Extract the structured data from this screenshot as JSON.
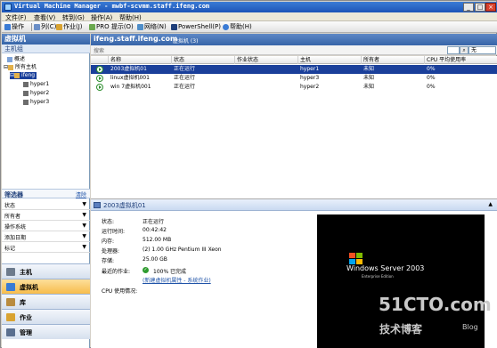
{
  "window": {
    "title": "Virtual Machine Manager - mwbf-scvmm.staff.ifeng.com"
  },
  "menu": [
    "文件(F)",
    "查看(V)",
    "转到(G)",
    "操作(A)",
    "帮助(H)"
  ],
  "toolbar": {
    "items": [
      "操作",
      "列(C)",
      "作业(J)",
      "PRO 提示(O)",
      "网络(N)",
      "PowerShell(P)",
      "帮助(H)"
    ]
  },
  "left": {
    "title": "虚拟机",
    "section": "主机组",
    "tree": [
      "概述",
      "所有主机",
      "ifeng",
      "hyper1",
      "hyper2",
      "hyper3"
    ],
    "filter": {
      "title": "筛选器",
      "clear": "清除",
      "rows": [
        "状态",
        "所有者",
        "操作系统",
        "添加日期",
        "标记"
      ]
    },
    "nav": [
      "主机",
      "虚拟机",
      "库",
      "作业",
      "管理"
    ]
  },
  "main": {
    "title": "ifeng.staff.ifeng.com",
    "subtitle": "虚拟机 (3)",
    "search_placeholder": "搜索",
    "search_scope": "无",
    "columns": [
      "名称",
      "状态",
      "作业状态",
      "主机",
      "所有者",
      "CPU 平均使用率"
    ],
    "rows": [
      {
        "name": "2003虚拟机01",
        "status": "正在运行",
        "job": "",
        "host": "hyper1",
        "owner": "未知",
        "cpu": "0%"
      },
      {
        "name": "linux虚拟机001",
        "status": "正在运行",
        "job": "",
        "host": "hyper3",
        "owner": "未知",
        "cpu": "0%"
      },
      {
        "name": "win 7虚拟机001",
        "status": "正在运行",
        "job": "",
        "host": "hyper2",
        "owner": "未知",
        "cpu": "0%"
      }
    ]
  },
  "detail": {
    "title": "2003虚拟机01",
    "fields": [
      {
        "label": "状态:",
        "value": "正在运行"
      },
      {
        "label": "运行时间:",
        "value": "00:42:42"
      },
      {
        "label": "内存:",
        "value": "512.00 MB"
      },
      {
        "label": "处理器:",
        "value": "(2) 1.00 GHz Pentium III Xeon"
      },
      {
        "label": "存储:",
        "value": "25.00 GB"
      }
    ],
    "recent_job_label": "最近的作业:",
    "recent_job_value": "100% 已完成",
    "recent_job_link": "(新建虚拟机属性 - 系统作业)",
    "cpu_label": "CPU 使用情况:",
    "thumb_line1": "Windows Server 2003",
    "thumb_line2": "Enterprise Edition"
  },
  "watermark": {
    "site": "51CTO.com",
    "tagline": "技术博客",
    "blog": "Blog"
  },
  "colors": {
    "selection": "#1a3f9a",
    "header": "#3664a8",
    "active_nav": "#f7bc4c"
  }
}
